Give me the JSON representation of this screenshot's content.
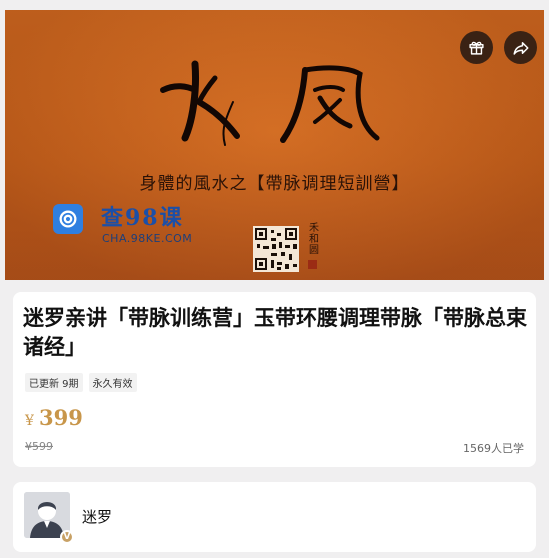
{
  "banner": {
    "calligraphy": "水風",
    "subtitle": "身體的風水之【帶脉调理短訓營】",
    "watermark_text": "查98课",
    "watermark_url": "CHA.98KE.COM",
    "side_text": "禾和圆",
    "icons": {
      "gift": "gift-icon",
      "share": "share-arrow-icon",
      "watermark": "brand-logo-icon"
    }
  },
  "course": {
    "title": "迷罗亲讲「带脉训练营」玉带环腰调理带脉「带脉总束诸经」",
    "tags": [
      "已更新 9期",
      "永久有效"
    ],
    "currency": "¥",
    "price": "399",
    "original_price": "¥599",
    "learners": "1569人已学"
  },
  "author": {
    "name": "迷罗",
    "badge": "V"
  },
  "colors": {
    "page_bg": "#f0eff0",
    "banner_bg": "#d2681f",
    "price": "#c8964a",
    "round_button_bg": "#3a2214"
  }
}
